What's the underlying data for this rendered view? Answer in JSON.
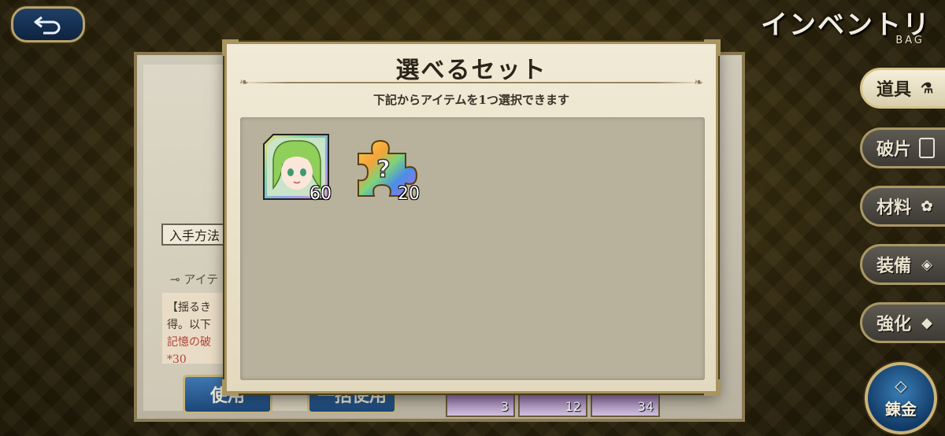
{
  "header": {
    "title": "インベントリ",
    "subtitle": "BAG"
  },
  "tabs": [
    {
      "label": "道具",
      "icon": "flask-icon",
      "glyph": "⚗",
      "active": true
    },
    {
      "label": "破片",
      "icon": "shard-icon",
      "glyph": "",
      "active": false
    },
    {
      "label": "材料",
      "icon": "flower-icon",
      "glyph": "✿",
      "active": false
    },
    {
      "label": "装備",
      "icon": "equipment-icon",
      "glyph": "◈",
      "active": false
    },
    {
      "label": "強化",
      "icon": "enhance-icon",
      "glyph": "◆",
      "active": false
    }
  ],
  "alchemy": {
    "label": "錬金"
  },
  "background_panel": {
    "method_label": "入手方法",
    "section_label": "アイテ",
    "desc_line1": "【揺るき",
    "desc_line2": "得。以下",
    "desc_line3": "記憶の破",
    "desc_line4": "*30",
    "use_button": "使用",
    "bulk_use_button": "一括使用",
    "slot_counts": [
      "3",
      "12",
      "34"
    ]
  },
  "modal": {
    "title": "選べるセット",
    "subtitle": "下記からアイテムを1つ選択できます",
    "items": [
      {
        "name": "character-shard",
        "count": "60"
      },
      {
        "name": "random-puzzle-piece",
        "count": "20"
      }
    ]
  },
  "colors": {
    "accent_gold": "#a8945f",
    "button_blue": "#1c4677",
    "modal_bg": "#f1ead6"
  }
}
